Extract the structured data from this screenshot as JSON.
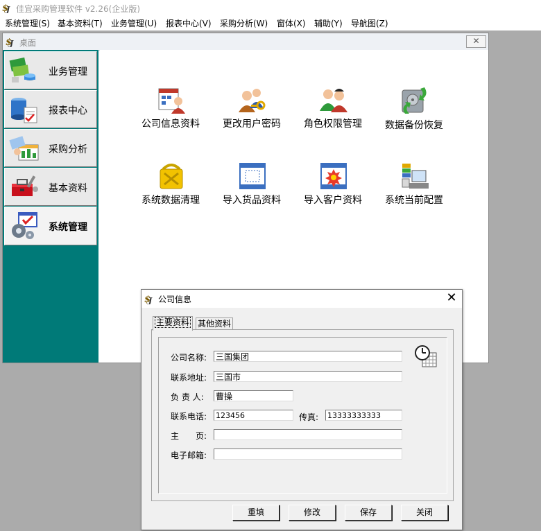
{
  "app": {
    "title": "佳宜采购管理软件 v2.26(企业版)"
  },
  "menu": [
    {
      "label": "系统管理(S)"
    },
    {
      "label": "基本资料(T)"
    },
    {
      "label": "业务管理(U)"
    },
    {
      "label": "报表中心(V)"
    },
    {
      "label": "采购分析(W)"
    },
    {
      "label": "窗体(X)"
    },
    {
      "label": "辅助(Y)"
    },
    {
      "label": "导航图(Z)"
    }
  ],
  "desktop": {
    "title": "桌面",
    "close_label": "☒",
    "nav": [
      {
        "label": "业务管理",
        "icon": "business-icon",
        "active": false
      },
      {
        "label": "报表中心",
        "icon": "report-icon",
        "active": false
      },
      {
        "label": "采购分析",
        "icon": "analysis-icon",
        "active": false
      },
      {
        "label": "基本资料",
        "icon": "toolbox-icon",
        "active": false
      },
      {
        "label": "系统管理",
        "icon": "system-settings-icon",
        "active": true
      }
    ],
    "tiles": [
      {
        "label": "公司信息资料",
        "icon": "company-info-icon"
      },
      {
        "label": "更改用户密码",
        "icon": "user-password-icon"
      },
      {
        "label": "角色权限管理",
        "icon": "role-permission-icon"
      },
      {
        "label": "数据备份恢复",
        "icon": "backup-restore-icon"
      },
      {
        "label": "系统数据清理",
        "icon": "data-cleanup-icon"
      },
      {
        "label": "导入货品资料",
        "icon": "import-goods-icon"
      },
      {
        "label": "导入客户资料",
        "icon": "import-customer-icon"
      },
      {
        "label": "系统当前配置",
        "icon": "system-config-icon"
      }
    ]
  },
  "dialog": {
    "title": "公司信息",
    "close": "✕",
    "tabs": [
      {
        "label": "主要资料",
        "selected": true
      },
      {
        "label": "其他资料",
        "selected": false
      }
    ],
    "fields": {
      "company_name": {
        "label": "公司名称:",
        "value": "三国集团"
      },
      "address": {
        "label": "联系地址:",
        "value": "三国市"
      },
      "manager": {
        "label": "负 责 人:",
        "value": "曹操"
      },
      "phone": {
        "label": "联系电话:",
        "value": "123456"
      },
      "fax": {
        "label": "传真:",
        "value": "13333333333"
      },
      "homepage": {
        "label": "主　　页:",
        "value": ""
      },
      "email": {
        "label": "电子邮箱:",
        "value": ""
      }
    },
    "buttons": {
      "reset": "重填",
      "edit": "修改",
      "save": "保存",
      "close": "关闭"
    }
  }
}
